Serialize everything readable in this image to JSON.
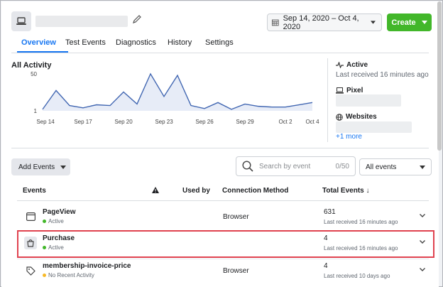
{
  "header": {
    "date_range": "Sep 14, 2020 – Oct 4, 2020",
    "create_label": "Create"
  },
  "tabs": [
    {
      "label": "Overview",
      "active": true
    },
    {
      "label": "Test Events"
    },
    {
      "label": "Diagnostics"
    },
    {
      "label": "History"
    },
    {
      "label": "Settings"
    }
  ],
  "activity": {
    "title": "All Activity"
  },
  "chart_data": {
    "type": "area",
    "title": "",
    "y_ticks": [
      "50",
      "1"
    ],
    "ylim": [
      1,
      50
    ],
    "x_tick_labels": [
      "Sep 14",
      "Sep 17",
      "Sep 20",
      "Sep 23",
      "Sep 26",
      "Sep 29",
      "Oct 2",
      "Oct 4"
    ],
    "x": [
      "Sep 14",
      "Sep 15",
      "Sep 16",
      "Sep 17",
      "Sep 18",
      "Sep 19",
      "Sep 20",
      "Sep 21",
      "Sep 22",
      "Sep 23",
      "Sep 24",
      "Sep 25",
      "Sep 26",
      "Sep 27",
      "Sep 28",
      "Sep 29",
      "Sep 30",
      "Oct 1",
      "Oct 2",
      "Oct 3",
      "Oct 4"
    ],
    "series": [
      {
        "values": [
          3,
          28,
          8,
          5,
          9,
          8,
          26,
          10,
          50,
          20,
          48,
          8,
          4,
          12,
          3,
          10,
          7,
          6,
          6,
          9,
          12
        ]
      }
    ],
    "color": "#4267b2",
    "fill": "#e7ecf7"
  },
  "side": {
    "active_title": "Active",
    "active_sub": "Last received 16 minutes ago",
    "pixel_title": "Pixel",
    "websites_title": "Websites",
    "more_link": "+1 more"
  },
  "controls": {
    "add_events": "Add Events",
    "search_placeholder": "Search by event",
    "search_count": "0/50",
    "filter_value": "All events"
  },
  "table": {
    "headers": {
      "events": "Events",
      "used_by": "Used by",
      "connection": "Connection Method",
      "total": "Total Events ↓"
    },
    "rows": [
      {
        "name": "PageView",
        "status": "Active",
        "status_color": "#42b72a",
        "method": "Browser",
        "total": "631",
        "last": "Last received 16 minutes ago"
      },
      {
        "name": "Purchase",
        "status": "Active",
        "status_color": "#42b72a",
        "method": "",
        "total": "4",
        "last": "Last received 16 minutes ago"
      },
      {
        "name": "membership-invoice-price",
        "status": "No Recent Activity",
        "status_color": "#f7b928",
        "method": "Browser",
        "total": "4",
        "last": "Last received 10 days ago"
      }
    ]
  }
}
